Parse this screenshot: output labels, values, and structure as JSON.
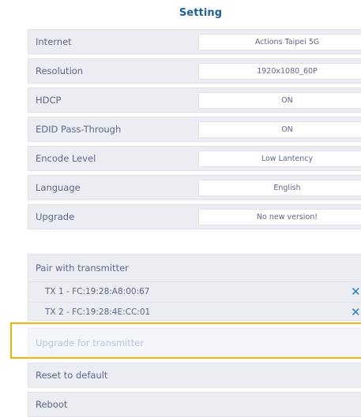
{
  "header": {
    "title": "Setting"
  },
  "settings": [
    {
      "label": "Internet",
      "value": "Actions Taipei 5G"
    },
    {
      "label": "Resolution",
      "value": "1920x1080_60P"
    },
    {
      "label": "HDCP",
      "value": "ON"
    },
    {
      "label": "EDID Pass-Through",
      "value": "ON"
    },
    {
      "label": "Encode Level",
      "value": "Low Lantency"
    },
    {
      "label": "Language",
      "value": "English"
    },
    {
      "label": "Upgrade",
      "value": "No new version!"
    }
  ],
  "pair": {
    "label": "Pair with transmitter",
    "transmitters": [
      {
        "label": "TX 1 - FC:19:28:A8:00:67",
        "remove_icon": "close-icon"
      },
      {
        "label": "TX 2 - FC:19:28:4E:CC:01",
        "remove_icon": "close-icon"
      }
    ]
  },
  "upgrade_transmitter": {
    "label": "Upgrade for transmitter"
  },
  "reset": {
    "label": "Reset to default"
  },
  "reboot": {
    "label": "Reboot"
  },
  "colors": {
    "title": "#1f5f97",
    "row_background": "#ecedf2",
    "text": "#5e6788",
    "highlight": "#f4b400",
    "close_icon": "#2c7fc1"
  }
}
